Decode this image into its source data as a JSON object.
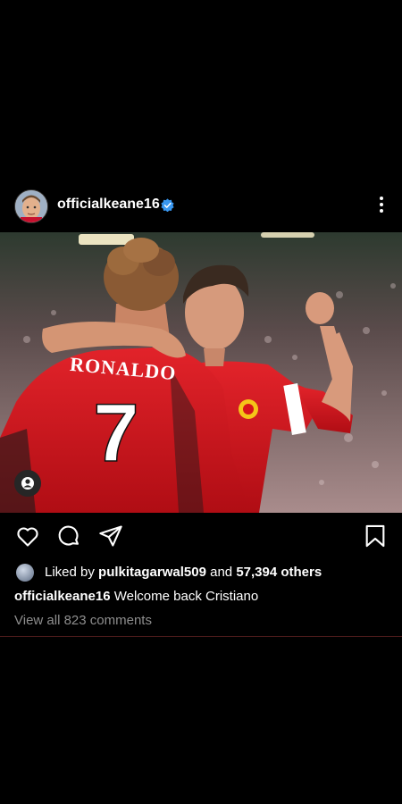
{
  "post": {
    "username": "officialkeane16",
    "verified": true,
    "likes": {
      "prefix": "Liked by",
      "user": "pulkitagarwal509",
      "conj": "and",
      "others": "57,394 others"
    },
    "caption": {
      "user": "officialkeane16",
      "text": "Welcome back Cristiano"
    },
    "view_comments": "View all 823 comments",
    "photo": {
      "jersey_name": "RONALDO",
      "jersey_number": "7"
    }
  },
  "icons": [
    "more-vertical-icon",
    "verified-badge-icon",
    "heart-icon",
    "comment-icon",
    "share-icon",
    "bookmark-icon",
    "user-tag-icon"
  ],
  "colors": {
    "accent": "#3897f0",
    "jersey_red": "#d7141a",
    "background": "#000000"
  }
}
